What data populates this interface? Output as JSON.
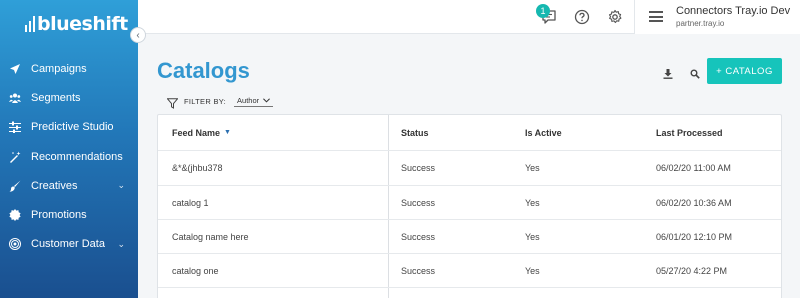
{
  "brand": {
    "logo_text": "blueshift"
  },
  "sidebar": {
    "items": [
      {
        "label": "Campaigns",
        "icon": "paper-plane-icon",
        "chevron": ""
      },
      {
        "label": "Segments",
        "icon": "users-icon",
        "chevron": ""
      },
      {
        "label": "Predictive Studio",
        "icon": "sliders-icon",
        "chevron": ""
      },
      {
        "label": "Recommendations",
        "icon": "magic-wand-icon",
        "chevron": ""
      },
      {
        "label": "Creatives",
        "icon": "brush-icon",
        "chevron": "⌄"
      },
      {
        "label": "Promotions",
        "icon": "gear-badge-icon",
        "chevron": ""
      },
      {
        "label": "Customer Data",
        "icon": "fingerprint-icon",
        "chevron": "⌄"
      }
    ]
  },
  "topbar": {
    "notification_count": "1",
    "user_name": "Connectors Tray.io Dev",
    "user_sub": "partner.tray.io"
  },
  "page": {
    "title": "Catalogs",
    "add_button": "+ CATALOG",
    "filter_label": "FILTER BY:",
    "filter_value": "Author"
  },
  "table": {
    "columns": [
      "Feed Name",
      "Status",
      "Is Active",
      "Last Processed"
    ],
    "rows": [
      [
        "&*&(jhbu378",
        "Success",
        "Yes",
        "06/02/20 11:00 AM"
      ],
      [
        "catalog 1",
        "Success",
        "Yes",
        "06/02/20 10:36 AM"
      ],
      [
        "Catalog name here",
        "Success",
        "Yes",
        "06/01/20 12:10 PM"
      ],
      [
        "catalog one",
        "Success",
        "Yes",
        "05/27/20 4:22 PM"
      ]
    ]
  },
  "colors": {
    "accent": "#3397d0",
    "button": "#16c4bb",
    "sidebar_top": "#2f9fd8",
    "sidebar_bottom": "#1a4f8f"
  }
}
